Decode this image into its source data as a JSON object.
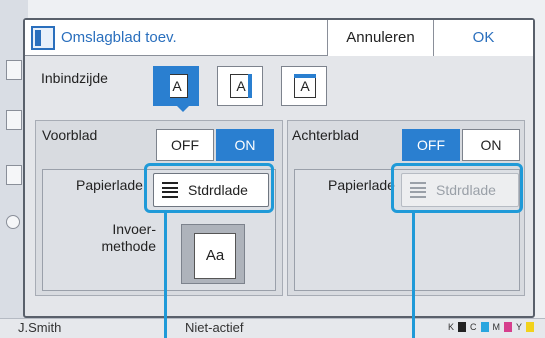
{
  "background": {
    "user": "J.Smith",
    "status": "Niet-actief",
    "toner": [
      "K",
      "C",
      "M",
      "Y"
    ]
  },
  "dialog": {
    "title": "Omslagblad toev.",
    "cancel_label": "Annuleren",
    "ok_label": "OK",
    "binding": {
      "label": "Inbindzijde",
      "options": [
        {
          "name": "left",
          "glyph": "A",
          "selected": true
        },
        {
          "name": "right",
          "glyph": "A",
          "selected": false
        },
        {
          "name": "top",
          "glyph": "A",
          "selected": false
        }
      ]
    },
    "front": {
      "label": "Voorblad",
      "off_label": "OFF",
      "on_label": "ON",
      "state": "ON",
      "paper_tray_label": "Papierlade",
      "paper_tray_value": "Stdrdlade",
      "feed_label_line1": "Invoer-",
      "feed_label_line2": "methode",
      "feed_glyph": "Aa"
    },
    "back": {
      "label": "Achterblad",
      "off_label": "OFF",
      "on_label": "ON",
      "state": "OFF",
      "paper_tray_label": "Papierlade",
      "paper_tray_value": "Stdrdlade"
    }
  },
  "colors": {
    "accent": "#2a7fd0",
    "highlight": "#1f9ad8"
  }
}
